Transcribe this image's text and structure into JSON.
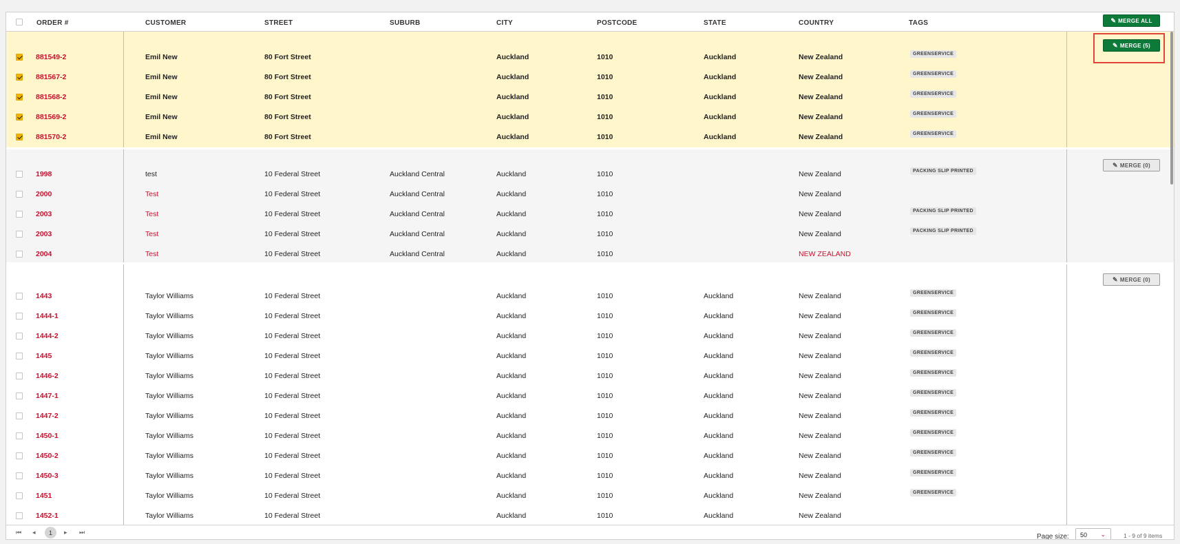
{
  "header": {
    "columns": [
      "ORDER #",
      "CUSTOMER",
      "STREET",
      "SUBURB",
      "CITY",
      "POSTCODE",
      "STATE",
      "COUNTRY",
      "TAGS"
    ],
    "merge_all_label": "MERGE ALL"
  },
  "groups": [
    {
      "merge_label": "MERGE (5)",
      "rows": [
        {
          "order": "881549-2",
          "customer": "Emil New",
          "street": "80 Fort Street",
          "suburb": "",
          "city": "Auckland",
          "postcode": "1010",
          "state": "Auckland",
          "country": "New Zealand",
          "tag": "GREENSERVICE"
        },
        {
          "order": "881567-2",
          "customer": "Emil New",
          "street": "80 Fort Street",
          "suburb": "",
          "city": "Auckland",
          "postcode": "1010",
          "state": "Auckland",
          "country": "New Zealand",
          "tag": "GREENSERVICE"
        },
        {
          "order": "881568-2",
          "customer": "Emil New",
          "street": "80 Fort Street",
          "suburb": "",
          "city": "Auckland",
          "postcode": "1010",
          "state": "Auckland",
          "country": "New Zealand",
          "tag": "GREENSERVICE"
        },
        {
          "order": "881569-2",
          "customer": "Emil New",
          "street": "80 Fort Street",
          "suburb": "",
          "city": "Auckland",
          "postcode": "1010",
          "state": "Auckland",
          "country": "New Zealand",
          "tag": "GREENSERVICE"
        },
        {
          "order": "881570-2",
          "customer": "Emil New",
          "street": "80 Fort Street",
          "suburb": "",
          "city": "Auckland",
          "postcode": "1010",
          "state": "Auckland",
          "country": "New Zealand",
          "tag": "GREENSERVICE"
        }
      ]
    },
    {
      "merge_label": "MERGE (0)",
      "rows": [
        {
          "order": "1998",
          "customer": "test",
          "street": "10 Federal Street",
          "suburb": "Auckland Central",
          "city": "Auckland",
          "postcode": "1010",
          "state": "",
          "country": "New Zealand",
          "tag": "PACKING SLIP PRINTED"
        },
        {
          "order": "2000",
          "customer": "Test",
          "street": "10 Federal Street",
          "suburb": "Auckland Central",
          "city": "Auckland",
          "postcode": "1010",
          "state": "",
          "country": "New Zealand",
          "tag": ""
        },
        {
          "order": "2003",
          "customer": "Test",
          "street": "10 Federal Street",
          "suburb": "Auckland Central",
          "city": "Auckland",
          "postcode": "1010",
          "state": "",
          "country": "New Zealand",
          "tag": "PACKING SLIP PRINTED"
        },
        {
          "order": "2003",
          "customer": "Test",
          "street": "10 Federal Street",
          "suburb": "Auckland Central",
          "city": "Auckland",
          "postcode": "1010",
          "state": "",
          "country": "New Zealand",
          "tag": "PACKING SLIP PRINTED"
        },
        {
          "order": "2004",
          "customer": "Test",
          "street": "10 Federal Street",
          "suburb": "Auckland Central",
          "city": "Auckland",
          "postcode": "1010",
          "state": "",
          "country": "NEW ZEALAND",
          "tag": ""
        }
      ]
    },
    {
      "merge_label": "MERGE (0)",
      "rows": [
        {
          "order": "1443",
          "customer": "Taylor Williams",
          "street": "10 Federal Street",
          "suburb": "",
          "city": "Auckland",
          "postcode": "1010",
          "state": "Auckland",
          "country": "New Zealand",
          "tag": "GREENSERVICE"
        },
        {
          "order": "1444-1",
          "customer": "Taylor Williams",
          "street": "10 Federal Street",
          "suburb": "",
          "city": "Auckland",
          "postcode": "1010",
          "state": "Auckland",
          "country": "New Zealand",
          "tag": "GREENSERVICE"
        },
        {
          "order": "1444-2",
          "customer": "Taylor Williams",
          "street": "10 Federal Street",
          "suburb": "",
          "city": "Auckland",
          "postcode": "1010",
          "state": "Auckland",
          "country": "New Zealand",
          "tag": "GREENSERVICE"
        },
        {
          "order": "1445",
          "customer": "Taylor Williams",
          "street": "10 Federal Street",
          "suburb": "",
          "city": "Auckland",
          "postcode": "1010",
          "state": "Auckland",
          "country": "New Zealand",
          "tag": "GREENSERVICE"
        },
        {
          "order": "1446-2",
          "customer": "Taylor Williams",
          "street": "10 Federal Street",
          "suburb": "",
          "city": "Auckland",
          "postcode": "1010",
          "state": "Auckland",
          "country": "New Zealand",
          "tag": "GREENSERVICE"
        },
        {
          "order": "1447-1",
          "customer": "Taylor Williams",
          "street": "10 Federal Street",
          "suburb": "",
          "city": "Auckland",
          "postcode": "1010",
          "state": "Auckland",
          "country": "New Zealand",
          "tag": "GREENSERVICE"
        },
        {
          "order": "1447-2",
          "customer": "Taylor Williams",
          "street": "10 Federal Street",
          "suburb": "",
          "city": "Auckland",
          "postcode": "1010",
          "state": "Auckland",
          "country": "New Zealand",
          "tag": "GREENSERVICE"
        },
        {
          "order": "1450-1",
          "customer": "Taylor Williams",
          "street": "10 Federal Street",
          "suburb": "",
          "city": "Auckland",
          "postcode": "1010",
          "state": "Auckland",
          "country": "New Zealand",
          "tag": "GREENSERVICE"
        },
        {
          "order": "1450-2",
          "customer": "Taylor Williams",
          "street": "10 Federal Street",
          "suburb": "",
          "city": "Auckland",
          "postcode": "1010",
          "state": "Auckland",
          "country": "New Zealand",
          "tag": "GREENSERVICE"
        },
        {
          "order": "1450-3",
          "customer": "Taylor Williams",
          "street": "10 Federal Street",
          "suburb": "",
          "city": "Auckland",
          "postcode": "1010",
          "state": "Auckland",
          "country": "New Zealand",
          "tag": "GREENSERVICE"
        },
        {
          "order": "1451",
          "customer": "Taylor Williams",
          "street": "10 Federal Street",
          "suburb": "",
          "city": "Auckland",
          "postcode": "1010",
          "state": "Auckland",
          "country": "New Zealand",
          "tag": "GREENSERVICE"
        },
        {
          "order": "1452-1",
          "customer": "Taylor Williams",
          "street": "10 Federal Street",
          "suburb": "",
          "city": "Auckland",
          "postcode": "1010",
          "state": "Auckland",
          "country": "New Zealand",
          "tag": ""
        }
      ]
    }
  ],
  "footer": {
    "current_page": "1",
    "page_size_label": "Page size:",
    "page_size_value": "50",
    "items_summary": "1 - 9 of 9 items"
  },
  "colors": {
    "accent_red": "#c8102e",
    "merge_green": "#0e7a3a",
    "selected_group_bg": "#fff6cc",
    "highlight_outline": "#e0443a"
  }
}
